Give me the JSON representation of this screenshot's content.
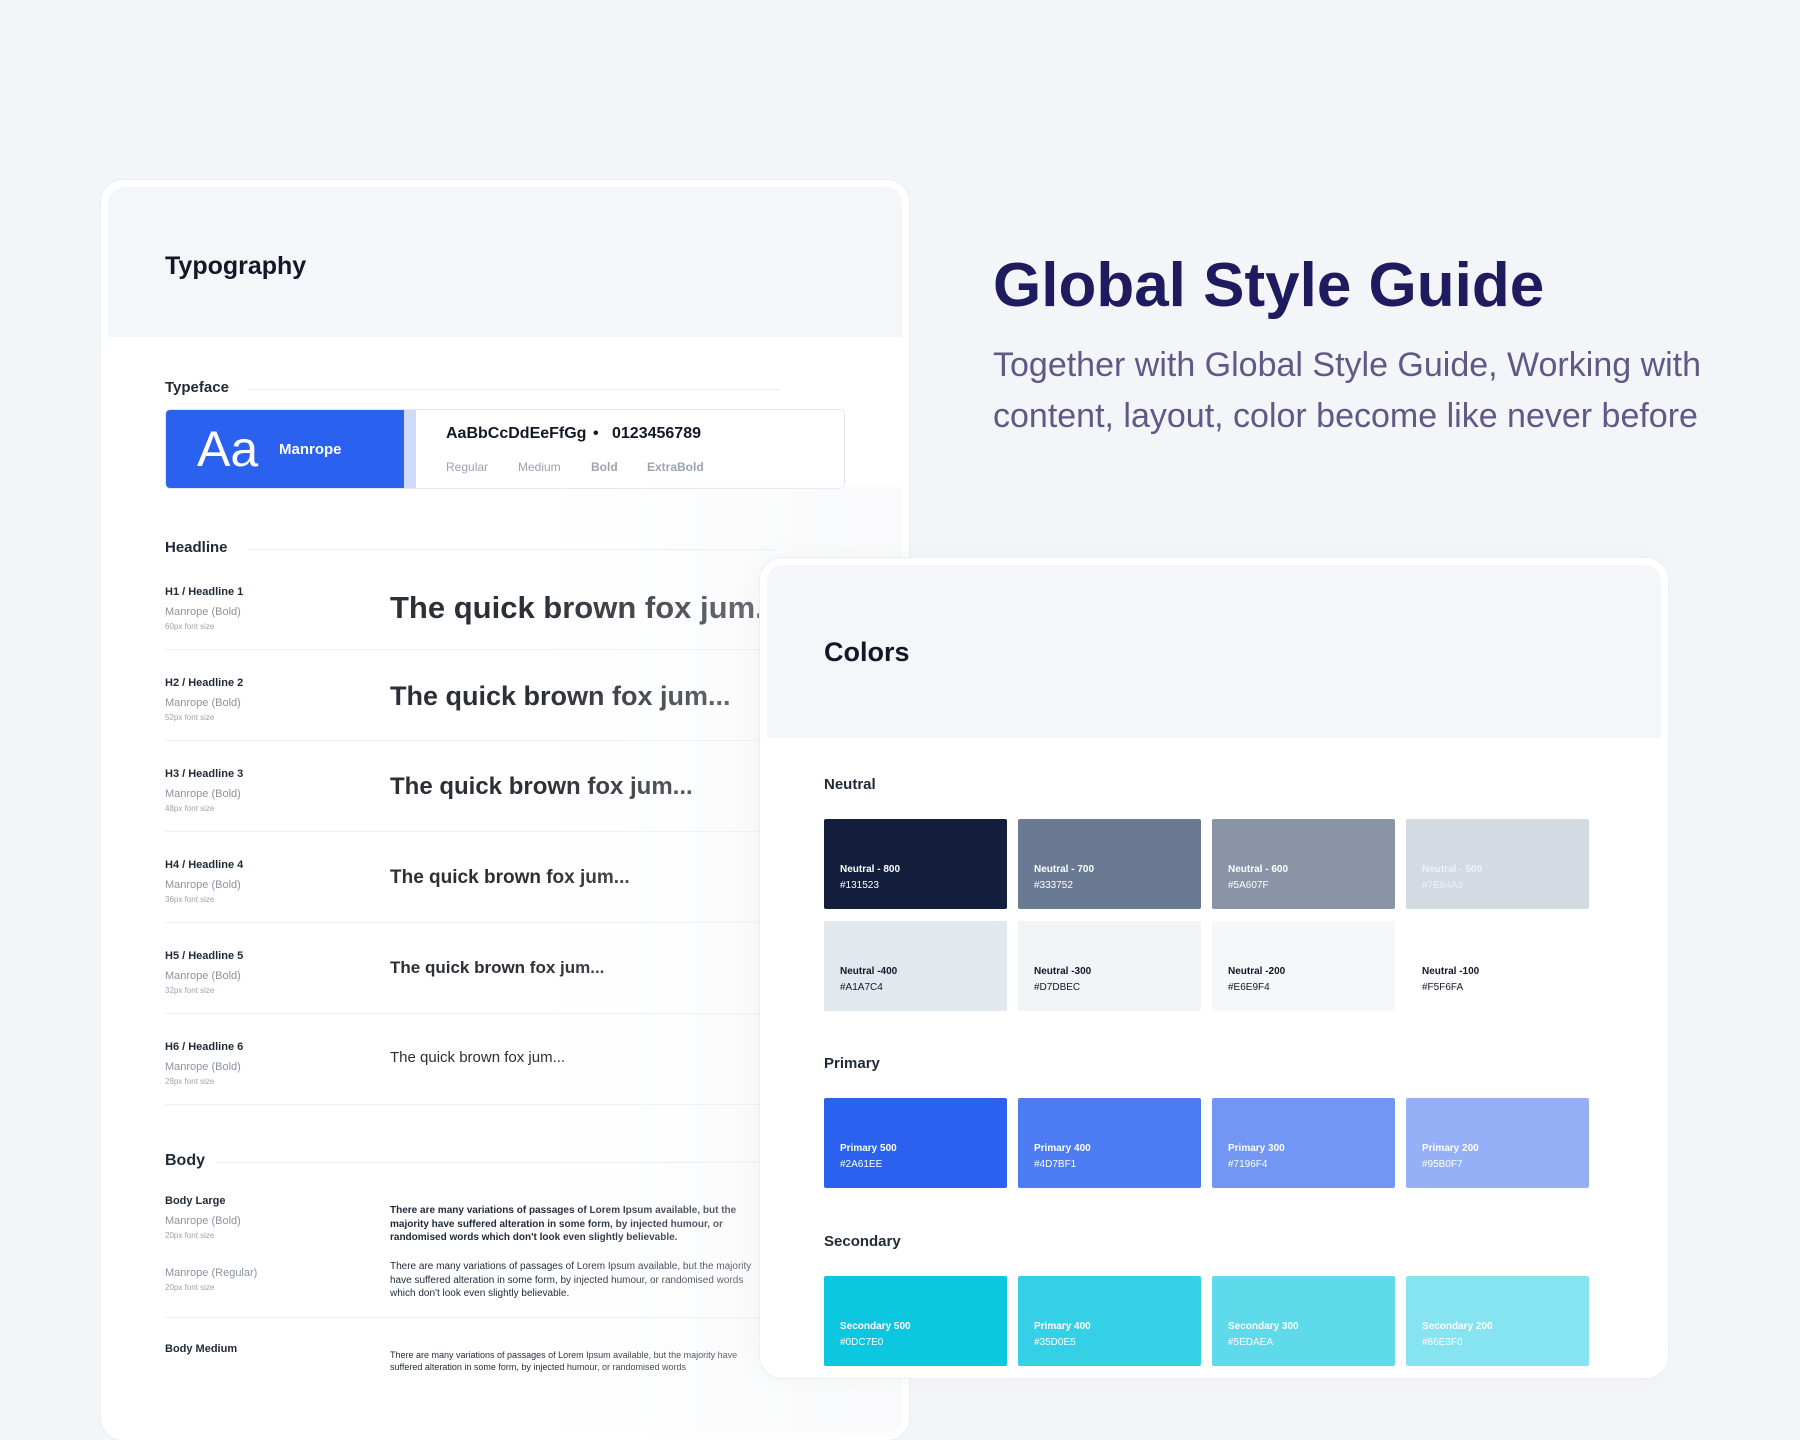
{
  "typography": {
    "title": "Typography",
    "typeface_label": "Typeface",
    "typeface": {
      "aa": "Aa",
      "name": "Manrope",
      "sample": "AaBbCcDdEeFfGg",
      "separator": "•",
      "digits": "0123456789",
      "weights": [
        "Regular",
        "Medium",
        "Bold",
        "ExtraBold"
      ]
    },
    "headline_label": "Headline",
    "headlines": [
      {
        "title": "H1 / Headline 1",
        "font": "Manrope (Bold)",
        "size": "60px font size",
        "sample": "The quick brown fox jum..."
      },
      {
        "title": "H2 / Headline 2",
        "font": "Manrope (Bold)",
        "size": "52px font size",
        "sample": "The quick brown fox jum..."
      },
      {
        "title": "H3 / Headline 3",
        "font": "Manrope (Bold)",
        "size": "48px font size",
        "sample": "The quick brown fox jum..."
      },
      {
        "title": "H4 / Headline 4",
        "font": "Manrope (Bold)",
        "size": "36px font size",
        "sample": "The quick brown fox jum..."
      },
      {
        "title": "H5 / Headline 5",
        "font": "Manrope (Bold)",
        "size": "32px font size",
        "sample": "The quick brown fox jum..."
      },
      {
        "title": "H6 / Headline 6",
        "font": "Manrope (Bold)",
        "size": "28px font size",
        "sample": "The quick brown fox jum..."
      }
    ],
    "body_label": "Body",
    "body": {
      "large_title": "Body Large",
      "large_bold_font": "Manrope (Bold)",
      "large_bold_size": "20px font size",
      "large_bold_text": "There are many variations of passages of Lorem Ipsum available, but the majority have suffered alteration in some form, by injected humour, or randomised words which don't look even slightly believable.",
      "large_regular_font": "Manrope (Regular)",
      "large_regular_size": "20px font size",
      "large_regular_text": "There are many variations of passages of Lorem Ipsum available, but the majority have suffered alteration in some form, by injected humour, or randomised words which don't look even slightly believable.",
      "medium_title": "Body Medium",
      "medium_text": "There are many variations of passages of Lorem Ipsum available, but the majority have suffered alteration in some form, by injected humour, or randomised words"
    }
  },
  "hero": {
    "title": "Global Style Guide",
    "subtitle": "Together with Global Style Guide, Working with content, layout, color become like never before"
  },
  "colors": {
    "title": "Colors",
    "neutral_label": "Neutral",
    "neutral": [
      {
        "name": "Neutral - 800",
        "hex": "#131523",
        "color": "#131f3d",
        "text": "#ffffff"
      },
      {
        "name": "Neutral - 700",
        "hex": "#333752",
        "color": "#6b7a93",
        "text": "#ffffff"
      },
      {
        "name": "Neutral - 600",
        "hex": "#5A607F",
        "color": "#8b93a6",
        "text": "#ffffff"
      },
      {
        "name": "Neutral - 500",
        "hex": "#7E84A3",
        "color": "#d3dae2",
        "text": "#eef1f5"
      },
      {
        "name": "Neutral -400",
        "hex": "#A1A7C4",
        "color": "#e3e8ef",
        "text": "#111827"
      },
      {
        "name": "Neutral -300",
        "hex": "#D7DBEC",
        "color": "#f1f4f7",
        "text": "#111827"
      },
      {
        "name": "Neutral -200",
        "hex": "#E6E9F4",
        "color": "#f6f7f9",
        "text": "#111827"
      },
      {
        "name": "Neutral -100",
        "hex": "#F5F6FA",
        "color": "#ffffff",
        "text": "#111827"
      }
    ],
    "primary_label": "Primary",
    "primary": [
      {
        "name": "Primary 500",
        "hex": "#2A61EE",
        "color": "#2a61ee",
        "text": "#ffffff"
      },
      {
        "name": "Primary 400",
        "hex": "#4D7BF1",
        "color": "#4d7bf1",
        "text": "#ffffff"
      },
      {
        "name": "Primary 300",
        "hex": "#7196F4",
        "color": "#7196f4",
        "text": "#ffffff"
      },
      {
        "name": "Primary 200",
        "hex": "#95B0F7",
        "color": "#95b0f7",
        "text": "#ffffff"
      }
    ],
    "secondary_label": "Secondary",
    "secondary": [
      {
        "name": "Secondary 500",
        "hex": "#0DC7E0",
        "color": "#0dc7e0",
        "text": "#ffffff"
      },
      {
        "name": "Primary 400",
        "hex": "#35D0E5",
        "color": "#35d0e5",
        "text": "#ffffff"
      },
      {
        "name": "Secondary 300",
        "hex": "#5EDAEA",
        "color": "#5edaea",
        "text": "#ffffff"
      },
      {
        "name": "Secondary 200",
        "hex": "#86E3F0",
        "color": "#86e3f0",
        "text": "#ffffff"
      }
    ]
  }
}
